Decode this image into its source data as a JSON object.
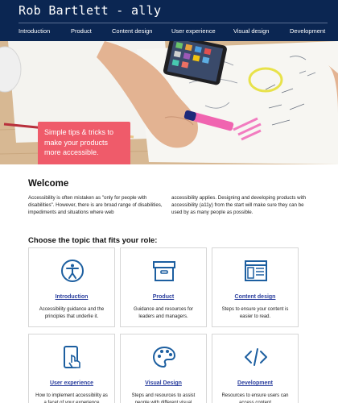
{
  "header": {
    "site_title": "Rob Bartlett - ally",
    "nav": [
      "Introduction",
      "Product",
      "Content design",
      "User experience",
      "Visual design",
      "Development"
    ]
  },
  "hero": {
    "callout": "Simple tips & tricks to make your products more accessible."
  },
  "welcome": {
    "heading": "Welcome",
    "paragraph_left": "Accessibility is often mistaken as \"only for people with disabilities\". However, there is are broad range of disabilities, impediments and situations where web",
    "paragraph_right": "accessibility applies. Designing and developing products with accessibility (a11y) from the start will make sure they can be used by as many people as possible."
  },
  "topics": {
    "heading": "Choose the topic that fits your role:",
    "cards": [
      {
        "title": "Introduction",
        "icon": "accessibility-person-icon",
        "desc": "Accessibility guidance and the principles that underlie it."
      },
      {
        "title": "Product",
        "icon": "archive-box-icon",
        "desc": "Guidance and resources for leaders and managers."
      },
      {
        "title": "Content design",
        "icon": "page-layout-icon",
        "desc": "Steps to ensure your content is easier to read."
      },
      {
        "title": "User experience",
        "icon": "tap-phone-icon",
        "desc": "How to implement accessibility as a facet of your experience"
      },
      {
        "title": "Visual Design",
        "icon": "paint-palette-icon",
        "desc": "Steps and resources to assist people with different visual"
      },
      {
        "title": "Development",
        "icon": "code-brackets-icon",
        "desc": "Resources to ensure users can access content"
      }
    ]
  },
  "colors": {
    "header_bg": "#0b2652",
    "accent_link": "#2b3f9e",
    "callout_bg": "#ef5b6a",
    "icon_blue": "#1d5fa0"
  }
}
